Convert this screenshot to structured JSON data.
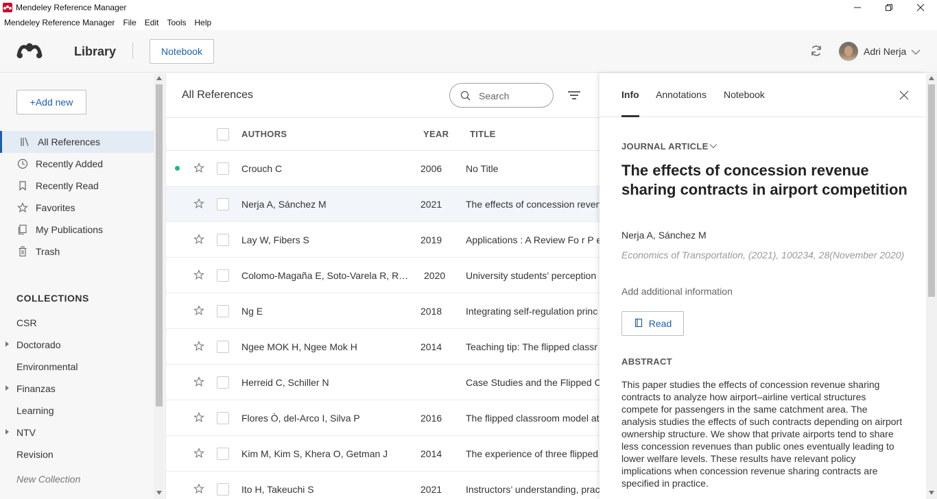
{
  "window": {
    "title": "Mendeley Reference Manager"
  },
  "menu": [
    "Mendeley Reference Manager",
    "File",
    "Edit",
    "Tools",
    "Help"
  ],
  "header": {
    "library_label": "Library",
    "notebook_button": "Notebook",
    "user_name": "Adri Nerja"
  },
  "sidebar": {
    "add_new_label": "+Add new",
    "nav": [
      {
        "label": "All References",
        "icon": "library-icon",
        "active": true
      },
      {
        "label": "Recently Added",
        "icon": "clock-icon"
      },
      {
        "label": "Recently Read",
        "icon": "bookmark-icon"
      },
      {
        "label": "Favorites",
        "icon": "star-icon"
      },
      {
        "label": "My Publications",
        "icon": "publication-icon"
      },
      {
        "label": "Trash",
        "icon": "trash-icon"
      }
    ],
    "collections_title": "COLLECTIONS",
    "collections": [
      {
        "label": "CSR",
        "expandable": false
      },
      {
        "label": "Doctorado",
        "expandable": true
      },
      {
        "label": "Environmental",
        "expandable": false
      },
      {
        "label": "Finanzas",
        "expandable": true
      },
      {
        "label": "Learning",
        "expandable": false
      },
      {
        "label": "NTV",
        "expandable": true
      },
      {
        "label": "Revision",
        "expandable": false
      }
    ],
    "new_collection_label": "New Collection"
  },
  "main": {
    "title": "All References",
    "search_placeholder": "Search",
    "columns": {
      "authors": "AUTHORS",
      "year": "YEAR",
      "title": "TITLE"
    },
    "rows": [
      {
        "authors": "Crouch C",
        "year": "2006",
        "title": "No Title",
        "unread": true
      },
      {
        "authors": "Nerja A, Sánchez M",
        "year": "2021",
        "title": "The effects of concession revenue",
        "selected": true
      },
      {
        "authors": "Lay W, Fibers S",
        "year": "2019",
        "title": "Applications : A Review Fo r P e"
      },
      {
        "authors": "Colomo-Magaña E, Soto-Varela R, Ruiz-Palmero J",
        "year": "2020",
        "title": " University students’ perception"
      },
      {
        "authors": "Ng E",
        "year": "2018",
        "title": "Integrating self-regulation princ"
      },
      {
        "authors": "Ngee MOK H, Ngee Mok H",
        "year": "2014",
        "title": "Teaching tip: The flipped classr"
      },
      {
        "authors": "Herreid C, Schiller N",
        "year": "",
        "title": "Case Studies and the Flipped C"
      },
      {
        "authors": "Flores Ò, del-Arco I, Silva P",
        "year": "2016",
        "title": "The flipped classroom model at"
      },
      {
        "authors": "Kim M, Kim S, Khera O, Getman J",
        "year": "2014",
        "title": "The experience of three flipped"
      },
      {
        "authors": "Ito H, Takeuchi S",
        "year": "2021",
        "title": "Instructors’ understanding, prac"
      }
    ]
  },
  "details": {
    "tabs": [
      "Info",
      "Annotations",
      "Notebook"
    ],
    "active_tab": "Info",
    "type": "JOURNAL ARTICLE",
    "title": "The effects of concession revenue sharing contracts in airport competition",
    "authors": "Nerja A, Sánchez M",
    "journal": "Economics of Transportation, (2021), 100234, 28(November 2020)",
    "add_info": "Add additional information",
    "read_button": "Read",
    "abstract_title": "ABSTRACT",
    "abstract": "This paper studies the effects of concession revenue sharing contracts to analyze how airport–airline vertical structures compete for passengers in the same catchment area. The analysis studies the effects of such contracts depending on airport ownership structure. We show that private airports tend to share less concession revenues than public ones eventually leading to lower welfare levels. These results have relevant policy implications when concession revenue sharing contracts are specified in practice."
  },
  "colors": {
    "accent": "#1f5fa6",
    "unread_dot": "#2bb37e",
    "selected_row": "#f2f6fb",
    "active_nav": "#e3ebf5"
  }
}
